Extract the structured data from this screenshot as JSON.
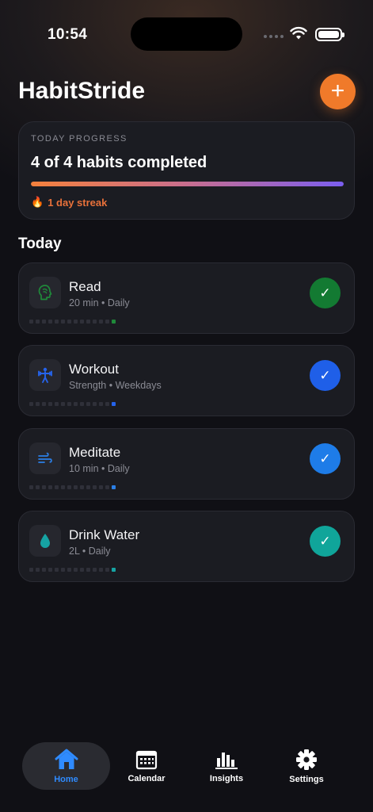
{
  "status_bar": {
    "time": "10:54"
  },
  "header": {
    "title": "HabitStride",
    "add_label": "+"
  },
  "progress": {
    "label": "TODAY PROGRESS",
    "summary": "4 of 4 habits completed",
    "completed_fraction": 1.0,
    "streak": "1 day streak"
  },
  "section": {
    "title": "Today"
  },
  "habits": [
    {
      "name": "Read",
      "meta": "20 min • Daily",
      "icon": "book-head-icon",
      "color": "#1f8a3a",
      "check_color": "#137a32"
    },
    {
      "name": "Workout",
      "meta": "Strength • Weekdays",
      "icon": "dumbbell-icon",
      "color": "#2563eb",
      "check_color": "#1f5fe8"
    },
    {
      "name": "Meditate",
      "meta": "10 min • Daily",
      "icon": "wind-icon",
      "color": "#2b7fe6",
      "check_color": "#1e7ce8"
    },
    {
      "name": "Drink Water",
      "meta": "2L • Daily",
      "icon": "water-drop-icon",
      "color": "#16a3a3",
      "check_color": "#10a59a"
    }
  ],
  "tabs": [
    {
      "label": "Home",
      "icon": "home-icon",
      "active": true
    },
    {
      "label": "Calendar",
      "icon": "calendar-icon",
      "active": false
    },
    {
      "label": "Insights",
      "icon": "bar-chart-icon",
      "active": false
    },
    {
      "label": "Settings",
      "icon": "gear-icon",
      "active": false
    }
  ],
  "colors": {
    "accent": "#f07a2a",
    "active_tab": "#2f8bff",
    "background": "#101015",
    "card": "#1b1c22"
  }
}
